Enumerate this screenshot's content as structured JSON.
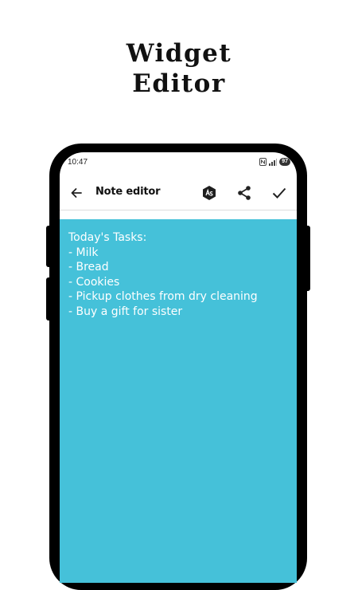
{
  "promo": {
    "title_line1": "Widget",
    "title_line2": "Editor"
  },
  "status_bar": {
    "time": "10:47",
    "battery": "97",
    "icons": [
      "nfc-icon",
      "signal-icon",
      "battery-icon"
    ]
  },
  "app_bar": {
    "title": "Note editor",
    "back_icon": "arrow-left-icon",
    "actions": [
      "font-style-icon",
      "share-icon",
      "check-icon"
    ]
  },
  "note": {
    "background_color": "#45c1d9",
    "text_color": "#ffffff",
    "content": "Today's Tasks:\n- Milk\n- Bread\n- Cookies\n- Pickup clothes from dry cleaning\n- Buy a gift for sister"
  }
}
